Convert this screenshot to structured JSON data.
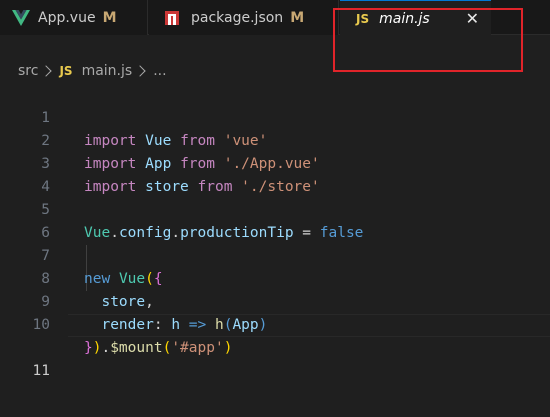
{
  "tabs": [
    {
      "label": "App.vue",
      "status": "M",
      "icon": "vue-icon"
    },
    {
      "label": "package.json",
      "status": "M",
      "icon": "npm-icon"
    },
    {
      "label": "main.js",
      "icon_text": "JS",
      "close": "✕",
      "active": true
    }
  ],
  "breadcrumb": {
    "folder": "src",
    "file_icon": "JS",
    "file": "main.js",
    "ellipsis": "..."
  },
  "editor": {
    "active_line": 11,
    "line_numbers": [
      "1",
      "2",
      "3",
      "4",
      "5",
      "6",
      "7",
      "8",
      "9",
      "10",
      "11"
    ],
    "lines": {
      "l1": {
        "kw": "import",
        "name": "Vue",
        "from": "from",
        "src": "'vue'"
      },
      "l2": {
        "kw": "import",
        "name": "App",
        "from": "from",
        "src": "'./App.vue'"
      },
      "l3": {
        "kw": "import",
        "name": "store",
        "from": "from",
        "src": "'./store'"
      },
      "l5": {
        "obj": "Vue",
        "dot1": ".",
        "prop1": "config",
        "dot2": ".",
        "prop2": "productionTip",
        "op": " = ",
        "val": "false"
      },
      "l7": {
        "kw": "new",
        "cls": "Vue",
        "paren": "(",
        "brace": "{"
      },
      "l8": {
        "prop": "store",
        "comma": ","
      },
      "l9": {
        "prop": "render",
        "colon": ": ",
        "param": "h",
        "arrow": " => ",
        "fn": "h",
        "open": "(",
        "arg": "App",
        "close": ")"
      },
      "l10": {
        "brace": "}",
        "paren": ")",
        "dot": ".",
        "method": "$mount",
        "open": "(",
        "arg": "'#app'",
        "close": ")"
      }
    }
  },
  "colors": {
    "background": "#1f1f1f",
    "tabbar": "#181818",
    "keyword": "#569cd6",
    "control_keyword": "#c586c0",
    "variable": "#9cdcfe",
    "class": "#4ec9b0",
    "string": "#ce9178",
    "function": "#dcdcaa",
    "modified": "#c8a873",
    "highlight_box": "#e0242a"
  }
}
